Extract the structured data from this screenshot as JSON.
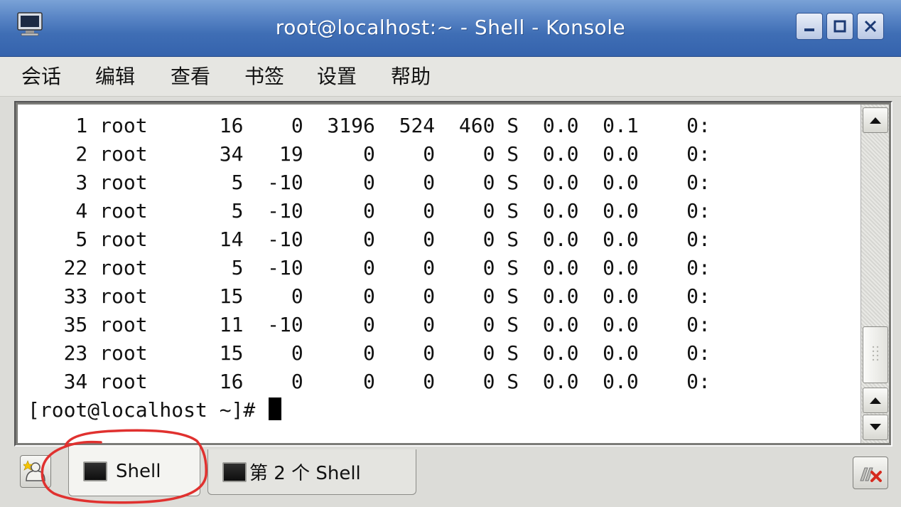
{
  "window": {
    "title": "root@localhost:~ - Shell - Konsole",
    "app_icon": "monitor-icon",
    "controls": [
      "minimize-icon",
      "maximize-icon",
      "close-icon"
    ]
  },
  "menu": {
    "items": [
      "会话",
      "编辑",
      "查看",
      "书签",
      "设置",
      "帮助"
    ]
  },
  "terminal": {
    "lines": [
      "    1 root      16    0  3196  524  460 S  0.0  0.1    0:",
      "    2 root      34   19     0    0    0 S  0.0  0.0    0:",
      "    3 root       5  -10     0    0    0 S  0.0  0.0    0:",
      "    4 root       5  -10     0    0    0 S  0.0  0.0    0:",
      "    5 root      14  -10     0    0    0 S  0.0  0.0    0:",
      "   22 root       5  -10     0    0    0 S  0.0  0.0    0:",
      "   33 root      15    0     0    0    0 S  0.0  0.0    0:",
      "   35 root      11  -10     0    0    0 S  0.0  0.0    0:",
      "   23 root      15    0     0    0    0 S  0.0  0.0    0:",
      "   34 root      16    0     0    0    0 S  0.0  0.0    0:"
    ],
    "prompt": "[root@localhost ~]# "
  },
  "scrollbar": {
    "up_icon": "arrow-up-icon",
    "down_icon": "arrow-down-icon"
  },
  "tabs": {
    "new_session_icon": "new-session-icon",
    "items": [
      {
        "label": "Shell",
        "active": true
      },
      {
        "label": "第 2 个 Shell",
        "active": false
      }
    ],
    "close_session_icon": "close-session-icon"
  },
  "colors": {
    "titlebar": "#3f6eb5",
    "annotation": "#e0312f",
    "terminal_bg": "#ffffff",
    "terminal_fg": "#111111"
  }
}
